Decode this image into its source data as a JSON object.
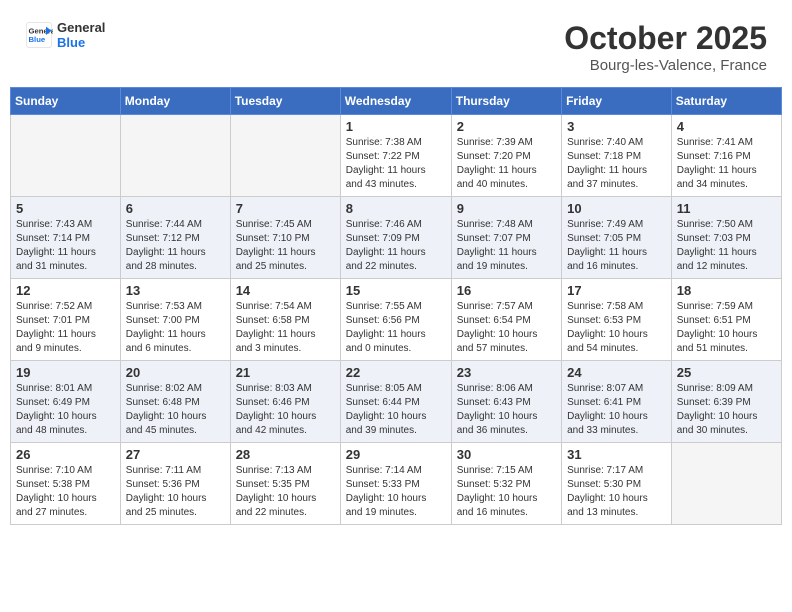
{
  "header": {
    "logo_line1": "General",
    "logo_line2": "Blue",
    "month": "October 2025",
    "location": "Bourg-les-Valence, France"
  },
  "weekdays": [
    "Sunday",
    "Monday",
    "Tuesday",
    "Wednesday",
    "Thursday",
    "Friday",
    "Saturday"
  ],
  "weeks": [
    [
      {
        "day": "",
        "info": ""
      },
      {
        "day": "",
        "info": ""
      },
      {
        "day": "",
        "info": ""
      },
      {
        "day": "1",
        "info": "Sunrise: 7:38 AM\nSunset: 7:22 PM\nDaylight: 11 hours\nand 43 minutes."
      },
      {
        "day": "2",
        "info": "Sunrise: 7:39 AM\nSunset: 7:20 PM\nDaylight: 11 hours\nand 40 minutes."
      },
      {
        "day": "3",
        "info": "Sunrise: 7:40 AM\nSunset: 7:18 PM\nDaylight: 11 hours\nand 37 minutes."
      },
      {
        "day": "4",
        "info": "Sunrise: 7:41 AM\nSunset: 7:16 PM\nDaylight: 11 hours\nand 34 minutes."
      }
    ],
    [
      {
        "day": "5",
        "info": "Sunrise: 7:43 AM\nSunset: 7:14 PM\nDaylight: 11 hours\nand 31 minutes."
      },
      {
        "day": "6",
        "info": "Sunrise: 7:44 AM\nSunset: 7:12 PM\nDaylight: 11 hours\nand 28 minutes."
      },
      {
        "day": "7",
        "info": "Sunrise: 7:45 AM\nSunset: 7:10 PM\nDaylight: 11 hours\nand 25 minutes."
      },
      {
        "day": "8",
        "info": "Sunrise: 7:46 AM\nSunset: 7:09 PM\nDaylight: 11 hours\nand 22 minutes."
      },
      {
        "day": "9",
        "info": "Sunrise: 7:48 AM\nSunset: 7:07 PM\nDaylight: 11 hours\nand 19 minutes."
      },
      {
        "day": "10",
        "info": "Sunrise: 7:49 AM\nSunset: 7:05 PM\nDaylight: 11 hours\nand 16 minutes."
      },
      {
        "day": "11",
        "info": "Sunrise: 7:50 AM\nSunset: 7:03 PM\nDaylight: 11 hours\nand 12 minutes."
      }
    ],
    [
      {
        "day": "12",
        "info": "Sunrise: 7:52 AM\nSunset: 7:01 PM\nDaylight: 11 hours\nand 9 minutes."
      },
      {
        "day": "13",
        "info": "Sunrise: 7:53 AM\nSunset: 7:00 PM\nDaylight: 11 hours\nand 6 minutes."
      },
      {
        "day": "14",
        "info": "Sunrise: 7:54 AM\nSunset: 6:58 PM\nDaylight: 11 hours\nand 3 minutes."
      },
      {
        "day": "15",
        "info": "Sunrise: 7:55 AM\nSunset: 6:56 PM\nDaylight: 11 hours\nand 0 minutes."
      },
      {
        "day": "16",
        "info": "Sunrise: 7:57 AM\nSunset: 6:54 PM\nDaylight: 10 hours\nand 57 minutes."
      },
      {
        "day": "17",
        "info": "Sunrise: 7:58 AM\nSunset: 6:53 PM\nDaylight: 10 hours\nand 54 minutes."
      },
      {
        "day": "18",
        "info": "Sunrise: 7:59 AM\nSunset: 6:51 PM\nDaylight: 10 hours\nand 51 minutes."
      }
    ],
    [
      {
        "day": "19",
        "info": "Sunrise: 8:01 AM\nSunset: 6:49 PM\nDaylight: 10 hours\nand 48 minutes."
      },
      {
        "day": "20",
        "info": "Sunrise: 8:02 AM\nSunset: 6:48 PM\nDaylight: 10 hours\nand 45 minutes."
      },
      {
        "day": "21",
        "info": "Sunrise: 8:03 AM\nSunset: 6:46 PM\nDaylight: 10 hours\nand 42 minutes."
      },
      {
        "day": "22",
        "info": "Sunrise: 8:05 AM\nSunset: 6:44 PM\nDaylight: 10 hours\nand 39 minutes."
      },
      {
        "day": "23",
        "info": "Sunrise: 8:06 AM\nSunset: 6:43 PM\nDaylight: 10 hours\nand 36 minutes."
      },
      {
        "day": "24",
        "info": "Sunrise: 8:07 AM\nSunset: 6:41 PM\nDaylight: 10 hours\nand 33 minutes."
      },
      {
        "day": "25",
        "info": "Sunrise: 8:09 AM\nSunset: 6:39 PM\nDaylight: 10 hours\nand 30 minutes."
      }
    ],
    [
      {
        "day": "26",
        "info": "Sunrise: 7:10 AM\nSunset: 5:38 PM\nDaylight: 10 hours\nand 27 minutes."
      },
      {
        "day": "27",
        "info": "Sunrise: 7:11 AM\nSunset: 5:36 PM\nDaylight: 10 hours\nand 25 minutes."
      },
      {
        "day": "28",
        "info": "Sunrise: 7:13 AM\nSunset: 5:35 PM\nDaylight: 10 hours\nand 22 minutes."
      },
      {
        "day": "29",
        "info": "Sunrise: 7:14 AM\nSunset: 5:33 PM\nDaylight: 10 hours\nand 19 minutes."
      },
      {
        "day": "30",
        "info": "Sunrise: 7:15 AM\nSunset: 5:32 PM\nDaylight: 10 hours\nand 16 minutes."
      },
      {
        "day": "31",
        "info": "Sunrise: 7:17 AM\nSunset: 5:30 PM\nDaylight: 10 hours\nand 13 minutes."
      },
      {
        "day": "",
        "info": ""
      }
    ]
  ]
}
